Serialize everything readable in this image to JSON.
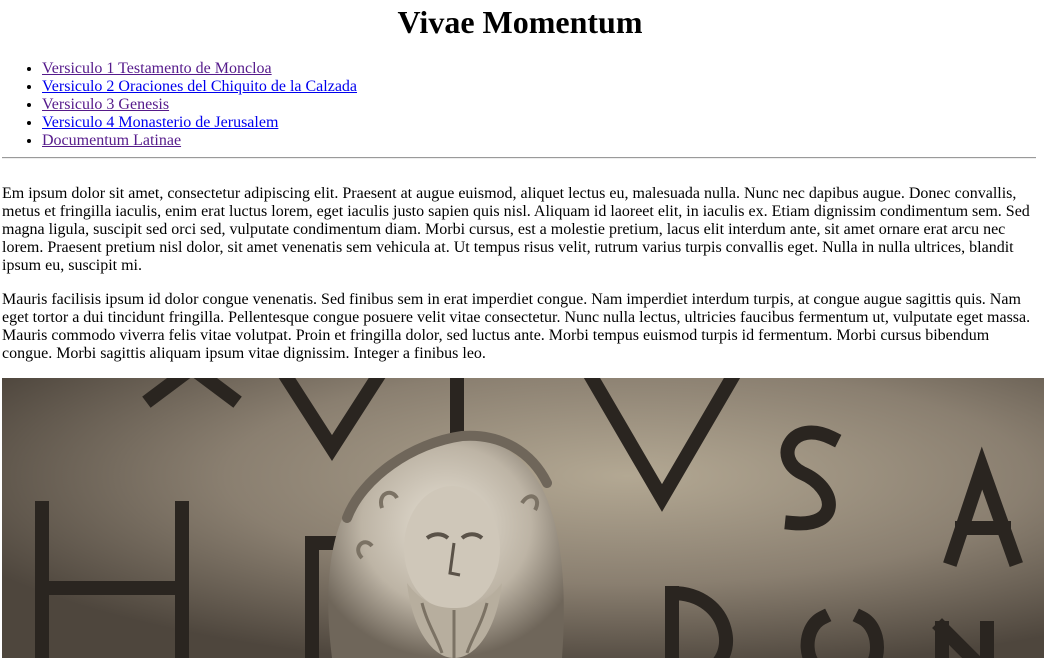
{
  "page": {
    "title": "Vivae Momentum"
  },
  "nav": {
    "items": [
      {
        "label": "Versiculo 1 Testamento de Moncloa",
        "visited": true
      },
      {
        "label": "Versiculo 2 Oraciones del Chiquito de la Calzada",
        "visited": false
      },
      {
        "label": "Versiculo 3 Genesis",
        "visited": true
      },
      {
        "label": "Versiculo 4 Monasterio de Jerusalem",
        "visited": false
      },
      {
        "label": "Documentum Latinae",
        "visited": true
      }
    ]
  },
  "content": {
    "paragraphs": [
      "Em ipsum dolor sit amet, consectetur adipiscing elit. Praesent at augue euismod, aliquet lectus eu, malesuada nulla. Nunc nec dapibus augue. Donec convallis, metus et fringilla iaculis, enim erat luctus lorem, eget iaculis justo sapien quis nisl. Aliquam id laoreet elit, in iaculis ex. Etiam dignissim condimentum sem. Sed magna ligula, suscipit sed orci sed, vulputate condimentum diam. Morbi cursus, est a molestie pretium, lacus elit interdum ante, sit amet ornare erat arcu nec lorem. Praesent pretium nisl dolor, sit amet venenatis sem vehicula at. Ut tempus risus velit, rutrum varius turpis convallis eget. Nulla in nulla ultrices, blandit ipsum eu, suscipit mi.",
      "Mauris facilisis ipsum id dolor congue venenatis. Sed finibus sem in erat imperdiet congue. Nam imperdiet interdum turpis, at congue augue sagittis quis. Nam eget tortor a dui tincidunt fringilla. Pellentesque congue posuere velit vitae consectetur. Nunc nulla lectus, ultricies faucibus fermentum ut, vulputate eget massa. Mauris commodo viverra felis vitae volutpat. Proin et fringilla dolor, sed luctus ante. Morbi tempus euismod turpis id fermentum. Morbi cursus bibendum congue. Morbi sagittis aliquam ipsum vitae dignissim. Integer a finibus leo."
    ]
  },
  "hero": {
    "icon": "roman-statue-relief-image",
    "inscription_letters": [
      "A",
      "V",
      "L",
      "V",
      "S",
      "A",
      "H",
      "E",
      "D",
      "O",
      "N"
    ],
    "colors": {
      "stone": "#8a7f70",
      "stone_dark": "#4a423a",
      "statue": "#d8d2c6",
      "letter": "#2a2520"
    }
  }
}
